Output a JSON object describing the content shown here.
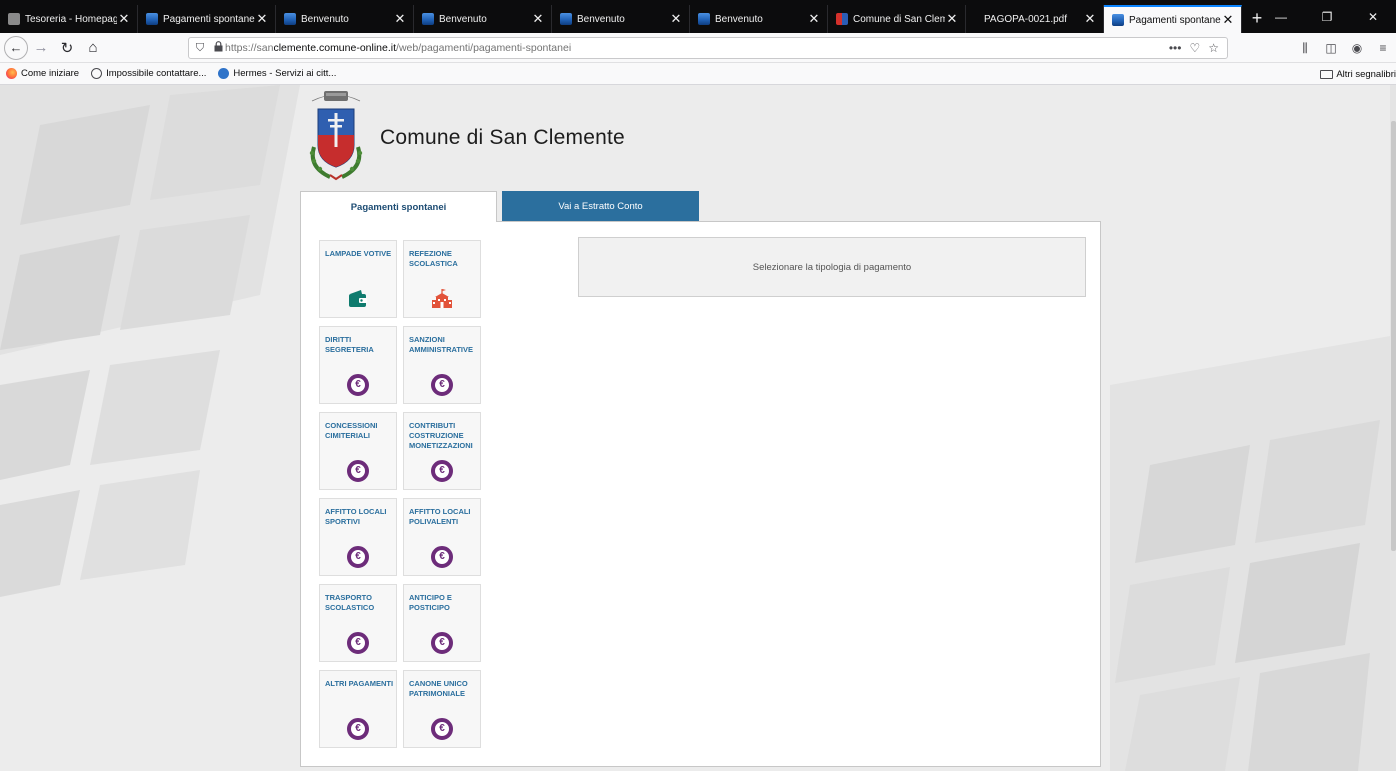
{
  "browser": {
    "tabs": [
      {
        "label": "Tesoreria - Homepage",
        "close": "✕",
        "favicon": "grey"
      },
      {
        "label": "Pagamenti spontanei",
        "close": "✕",
        "favicon": "blue"
      },
      {
        "label": "Benvenuto",
        "close": "✕",
        "favicon": "blue"
      },
      {
        "label": "Benvenuto",
        "close": "✕",
        "favicon": "blue"
      },
      {
        "label": "Benvenuto",
        "close": "✕",
        "favicon": "blue"
      },
      {
        "label": "Benvenuto",
        "close": "✕",
        "favicon": "blue"
      },
      {
        "label": "Comune di San Clemente",
        "close": "✕",
        "favicon": "red"
      },
      {
        "label": "PAGOPA-0021.pdf",
        "close": "✕",
        "favicon": "none"
      },
      {
        "label": "Pagamenti spontanei",
        "close": "✕",
        "favicon": "blue",
        "active": true
      }
    ],
    "new_tab": "+",
    "window_controls": {
      "minimize": "—",
      "maximize": "❐",
      "close": "✕"
    },
    "url_prefix": "https://san",
    "url_domain": "clemente.comune-online.it",
    "url_path": "/web/pagamenti/pagamenti-spontanei",
    "bookmarks": [
      {
        "label": "Come iniziare",
        "icon": "firefox-icon"
      },
      {
        "label": "Impossibile contattare...",
        "icon": "globe-icon"
      },
      {
        "label": "Hermes - Servizi ai citt...",
        "icon": "hermes-icon"
      }
    ],
    "other_bookmarks": "Altri segnalibri"
  },
  "site": {
    "title": "Comune di San Clemente",
    "crest_text": "COMUNE DI SAN CLEMENTE"
  },
  "page_tabs": {
    "active": "Pagamenti spontanei",
    "inactive": "Vai a Estratto Conto"
  },
  "tiles": [
    {
      "label": "LAMPADE VOTIVE",
      "icon": "wallet-icon"
    },
    {
      "label": "REFEZIONE SCOLASTICA",
      "icon": "school-icon"
    },
    {
      "label": "DIRITTI SEGRETERIA",
      "icon": "euro-icon"
    },
    {
      "label": "SANZIONI AMMINISTRATIVE",
      "icon": "euro-icon"
    },
    {
      "label": "CONCESSIONI CIMITERIALI",
      "icon": "euro-icon"
    },
    {
      "label": "CONTRIBUTI COSTRUZIONE MONETIZZAZIONI",
      "icon": "euro-icon"
    },
    {
      "label": "AFFITTO LOCALI SPORTIVI",
      "icon": "euro-icon"
    },
    {
      "label": "AFFITTO LOCALI POLIVALENTI",
      "icon": "euro-icon"
    },
    {
      "label": "TRASPORTO SCOLASTICO",
      "icon": "euro-icon"
    },
    {
      "label": "ANTICIPO E POSTICIPO",
      "icon": "euro-icon"
    },
    {
      "label": "ALTRI PAGAMENTI",
      "icon": "euro-icon"
    },
    {
      "label": "CANONE UNICO PATRIMONIALE",
      "icon": "euro-icon"
    }
  ],
  "euro_symbol": "€",
  "selection_prompt": "Selezionare la tipologia di pagamento",
  "colors": {
    "tab_active": "#2b6f9e",
    "tile_label": "#2b6f9e",
    "euro_icon": "#6d2c7a",
    "wallet_icon": "#0f7b6e",
    "school_icon": "#e2533a"
  }
}
